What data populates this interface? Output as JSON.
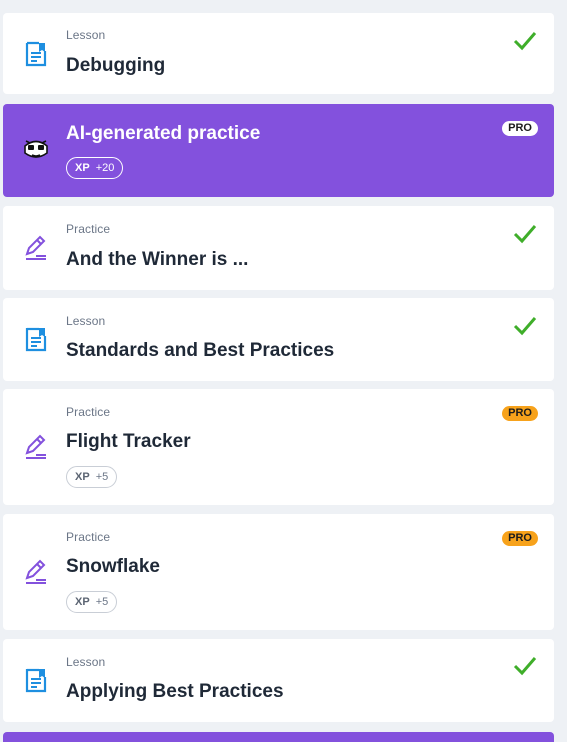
{
  "items": [
    {
      "kind": "Lesson",
      "title": "Debugging",
      "status": "completed",
      "icon": "lesson-document-icon"
    },
    {
      "kind": "",
      "title": "AI-generated practice",
      "badge": "PRO",
      "xp_label": "XP",
      "xp_value": "+20",
      "icon": "robot-face-icon"
    },
    {
      "kind": "Practice",
      "title": "And the Winner is ...",
      "status": "completed",
      "icon": "practice-pencil-icon"
    },
    {
      "kind": "Lesson",
      "title": "Standards and Best Practices",
      "status": "completed",
      "icon": "lesson-document-icon"
    },
    {
      "kind": "Practice",
      "title": "Flight Tracker",
      "badge": "PRO",
      "xp_label": "XP",
      "xp_value": "+5",
      "icon": "practice-pencil-icon"
    },
    {
      "kind": "Practice",
      "title": "Snowflake",
      "badge": "PRO",
      "xp_label": "XP",
      "xp_value": "+5",
      "icon": "practice-pencil-icon"
    },
    {
      "kind": "Lesson",
      "title": "Applying Best Practices",
      "status": "completed",
      "icon": "lesson-document-icon"
    }
  ],
  "colors": {
    "accent_purple": "#8351dd",
    "check_green": "#3fae2a",
    "pro_orange": "#f7a21b",
    "lesson_blue": "#1e8fe0",
    "practice_purple": "#8351dd"
  }
}
